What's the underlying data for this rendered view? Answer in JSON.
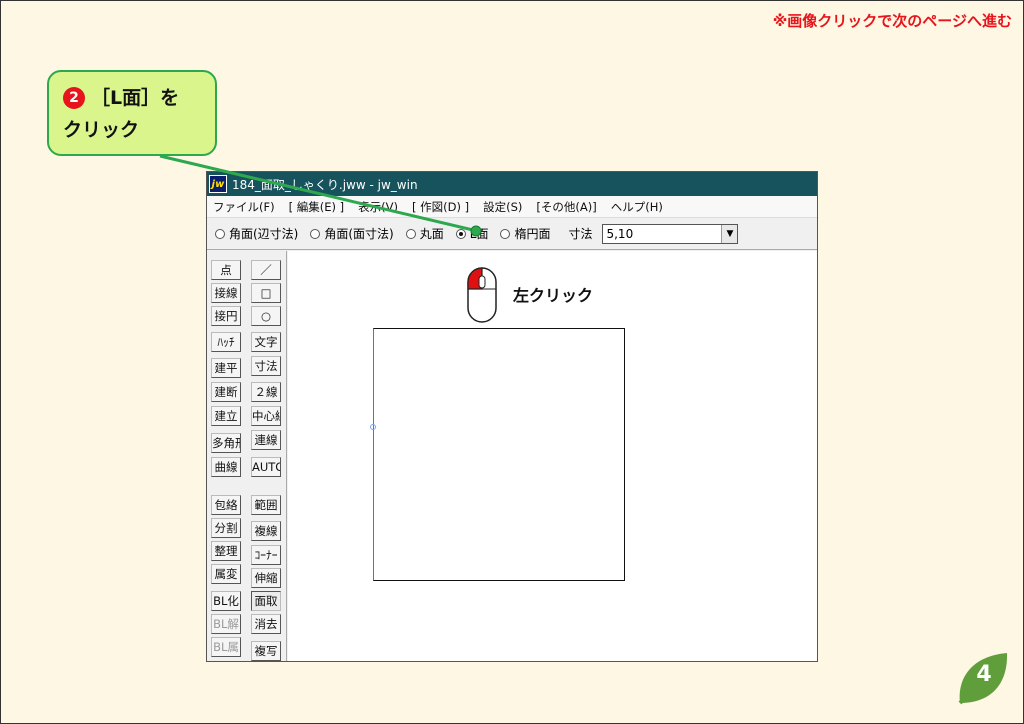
{
  "nav_hint": "※画像クリックで次のページへ進む",
  "callout": {
    "badge": "❷",
    "line1": "［L面］を",
    "line2": "クリック"
  },
  "window": {
    "title": "184_面取_しゃくり.jww - jw_win",
    "logo": "jw",
    "menu": [
      "ファイル(F)",
      "[ 編集(E) ]",
      "表示(V)",
      "[ 作図(D) ]",
      "設定(S)",
      "[その他(A)]",
      "ヘルプ(H)"
    ],
    "options": [
      {
        "label": "角面(辺寸法)",
        "checked": false
      },
      {
        "label": "角面(面寸法)",
        "checked": false
      },
      {
        "label": "丸面",
        "checked": false
      },
      {
        "label": "L面",
        "checked": true
      },
      {
        "label": "楕円面",
        "checked": false
      }
    ],
    "dimension_label": "寸法",
    "dimension_value": "5,10"
  },
  "toolbox": {
    "left": [
      "点",
      "接線",
      "接円",
      "ﾊｯﾁ",
      "建平",
      "建断",
      "建立",
      "多角形",
      "曲線",
      "包絡",
      "分割",
      "整理",
      "属変",
      "BL化",
      "BL解",
      "BL属"
    ],
    "right": [
      "／",
      "□",
      "○",
      "文字",
      "寸法",
      "２線",
      "中心線",
      "連線",
      "AUTO",
      "範囲",
      "複線",
      "ｺｰﾅｰ",
      "伸縮",
      "面取",
      "消去",
      "複写"
    ],
    "active": "面取",
    "disabled": [
      "BL解",
      "BL属"
    ]
  },
  "instruction": "左クリック",
  "page_number": "4",
  "colors": {
    "background": "#fdf7e3",
    "accent_red": "#e8141b",
    "callout_fill": "#d9f58c",
    "callout_border": "#2ea84e",
    "titlebar": "#17535c"
  }
}
